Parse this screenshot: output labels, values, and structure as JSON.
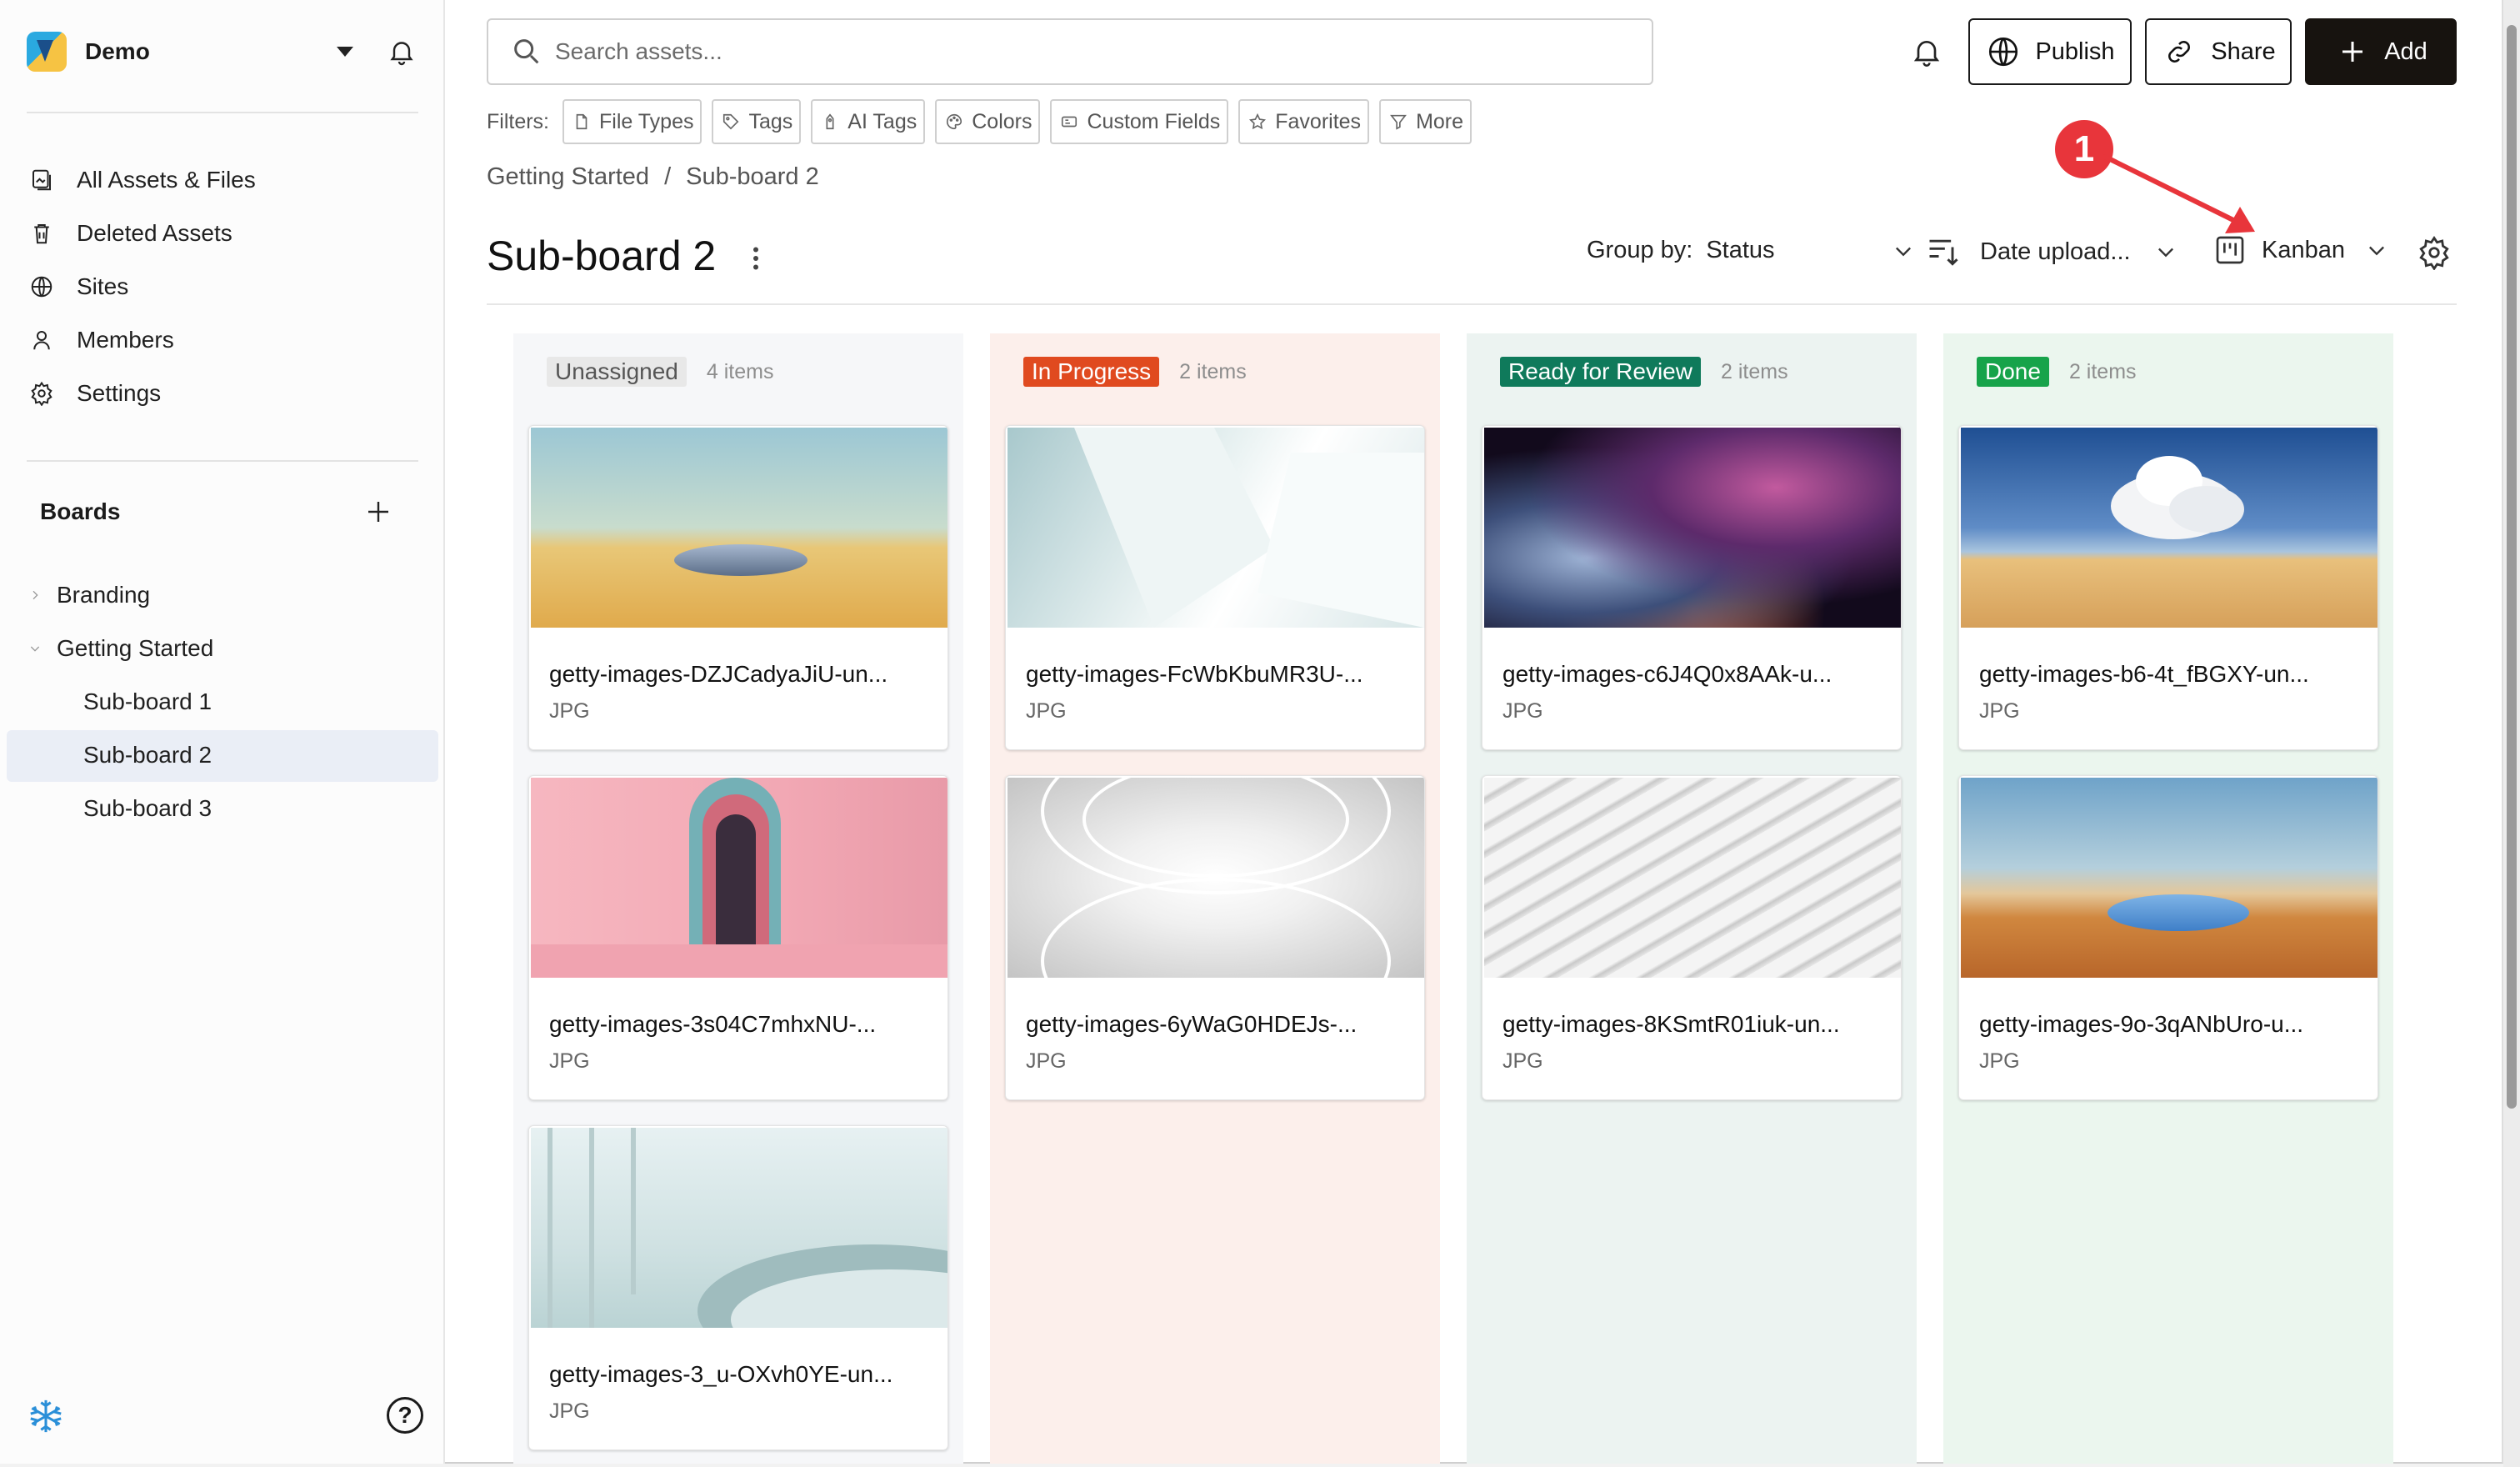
{
  "workspace": {
    "name": "Demo"
  },
  "nav": [
    {
      "label": "All Assets & Files",
      "icon": "assets-icon"
    },
    {
      "label": "Deleted Assets",
      "icon": "trash-icon"
    },
    {
      "label": "Sites",
      "icon": "globe-icon"
    },
    {
      "label": "Members",
      "icon": "user-icon"
    },
    {
      "label": "Settings",
      "icon": "gear-icon"
    }
  ],
  "boards": {
    "heading": "Boards",
    "tree": [
      {
        "label": "Branding",
        "expanded": false
      },
      {
        "label": "Getting Started",
        "expanded": true
      },
      {
        "label": "Sub-board 1"
      },
      {
        "label": "Sub-board 2",
        "selected": true
      },
      {
        "label": "Sub-board 3"
      }
    ]
  },
  "search": {
    "placeholder": "Search assets..."
  },
  "toolbar": {
    "publish": "Publish",
    "share": "Share",
    "add": "Add"
  },
  "filters": {
    "label": "Filters:",
    "chips": [
      "File Types",
      "Tags",
      "AI Tags",
      "Colors",
      "Custom Fields",
      "Favorites",
      "More"
    ]
  },
  "breadcrumb": {
    "parent": "Getting Started",
    "sep": "/",
    "current": "Sub-board 2"
  },
  "page": {
    "title": "Sub-board 2"
  },
  "view_controls": {
    "group_by_label": "Group by:",
    "group_by_value": "Status",
    "sort_value": "Date upload...",
    "view_value": "Kanban"
  },
  "annotation": {
    "number": "1"
  },
  "colors": {
    "in_progress": "#e04a1f",
    "ready_for_review": "#0f7a5b",
    "done": "#17a34a",
    "unassigned_pill": "#e8e8e8",
    "annotation": "#e8353b"
  },
  "columns": [
    {
      "status": "Unassigned",
      "count": "4 items",
      "cards": [
        {
          "name": "getty-images-DZJCadyaJiU-un...",
          "type": "JPG",
          "image": "desert-mirror"
        },
        {
          "name": "getty-images-3s04C7mhxNU-...",
          "type": "JPG",
          "image": "pink-arches"
        },
        {
          "name": "getty-images-3_u-OXvh0YE-un...",
          "type": "JPG",
          "image": "white-interior"
        }
      ]
    },
    {
      "status": "In Progress",
      "count": "2 items",
      "cards": [
        {
          "name": "getty-images-FcWbKbuMR3U-...",
          "type": "JPG",
          "image": "abstract-planes"
        },
        {
          "name": "getty-images-6yWaG0HDEJs-...",
          "type": "JPG",
          "image": "white-waves-tunnel"
        }
      ]
    },
    {
      "status": "Ready for Review",
      "count": "2 items",
      "cards": [
        {
          "name": "getty-images-c6J4Q0x8AAk-u...",
          "type": "JPG",
          "image": "nebula"
        },
        {
          "name": "getty-images-8KSmtR01iuk-un...",
          "type": "JPG",
          "image": "white-waves"
        }
      ]
    },
    {
      "status": "Done",
      "count": "2 items",
      "cards": [
        {
          "name": "getty-images-b6-4t_fBGXY-un...",
          "type": "JPG",
          "image": "desert-cloud"
        },
        {
          "name": "getty-images-9o-3qANbUro-u...",
          "type": "JPG",
          "image": "desert-sunset-mirror"
        }
      ]
    }
  ]
}
